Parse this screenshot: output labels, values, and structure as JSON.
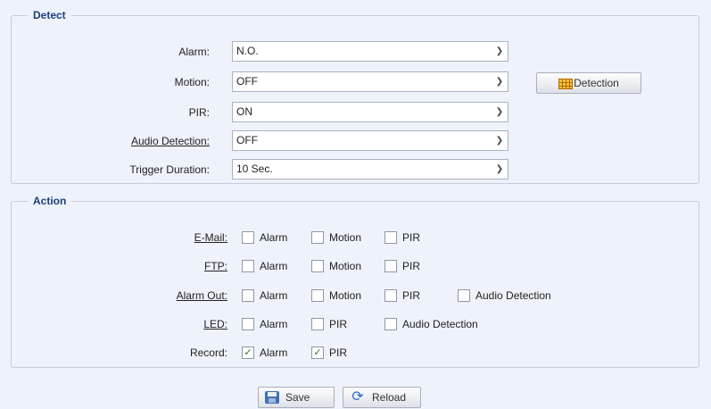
{
  "detect": {
    "legend": "Detect",
    "rows": [
      {
        "label": "Alarm:",
        "value": "N.O."
      },
      {
        "label": "Motion:",
        "value": "OFF"
      },
      {
        "label": "PIR:",
        "value": "ON"
      },
      {
        "label": "Audio Detection:",
        "value": "OFF"
      },
      {
        "label": "Trigger Duration:",
        "value": "10 Sec."
      }
    ],
    "detection_button": "Detection"
  },
  "action": {
    "legend": "Action",
    "rows": [
      {
        "label": "E-Mail:",
        "items": [
          {
            "text": "Alarm",
            "checked": false
          },
          {
            "text": "Motion",
            "checked": false
          },
          {
            "text": "PIR",
            "checked": false
          }
        ]
      },
      {
        "label": "FTP:",
        "items": [
          {
            "text": "Alarm",
            "checked": false
          },
          {
            "text": "Motion",
            "checked": false
          },
          {
            "text": "PIR",
            "checked": false
          }
        ]
      },
      {
        "label": "Alarm Out:",
        "items": [
          {
            "text": "Alarm",
            "checked": false
          },
          {
            "text": "Motion",
            "checked": false
          },
          {
            "text": "PIR",
            "checked": false
          },
          {
            "text": "Audio Detection",
            "checked": false
          }
        ]
      },
      {
        "label": "LED:",
        "items": [
          {
            "text": "Alarm",
            "checked": false
          },
          {
            "text": "PIR",
            "checked": false
          },
          {
            "text": "Audio Detection",
            "checked": false
          }
        ]
      },
      {
        "label": "Record:",
        "items": [
          {
            "text": "Alarm",
            "checked": true
          },
          {
            "text": "PIR",
            "checked": true
          }
        ]
      }
    ]
  },
  "footer": {
    "save_label": "Save",
    "reload_label": "Reload"
  },
  "icons": {
    "dropdown": "chevron-down-icon",
    "detection": "grid-icon",
    "save": "disk-icon",
    "reload": "reload-icon",
    "check": "check-icon"
  }
}
